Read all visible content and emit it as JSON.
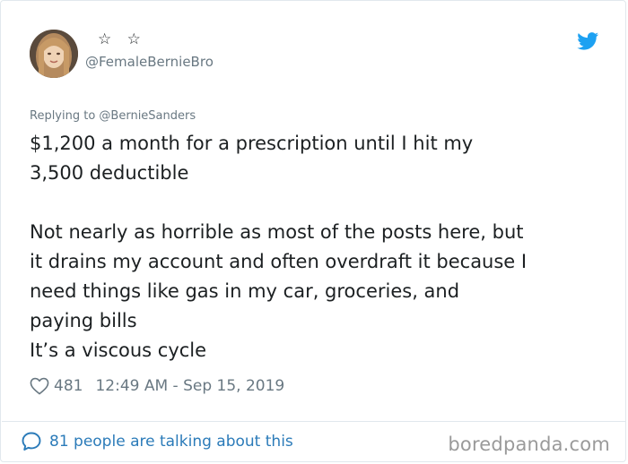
{
  "tweet": {
    "stars": "☆ ☆",
    "handle": "@FemaleBernieBro",
    "replying_to": "Replying to @BernieSanders",
    "text_paragraph_1": "$1,200 a month for a prescription until I hit my\n3,500 deductible",
    "text_paragraph_2": "Not nearly as horrible as most of the posts here, but\nit drains my account and often overdraft it because I\nneed things like gas in my car, groceries, and\npaying bills\nIt’s a viscous cycle",
    "likes": "481",
    "timestamp": "12:49 AM - Sep 15, 2019",
    "talking_label": "81 people are talking about this"
  },
  "watermark": "boredpanda.com",
  "icons": {
    "brand": "twitter-bird-icon",
    "like": "heart-outline-icon",
    "reply": "speech-bubble-icon"
  },
  "colors": {
    "twitter_blue": "#1da1f2",
    "link_blue": "#2b7bb9",
    "secondary_text": "#697882",
    "primary_text": "#1c2022",
    "border": "#e1e8ed"
  }
}
